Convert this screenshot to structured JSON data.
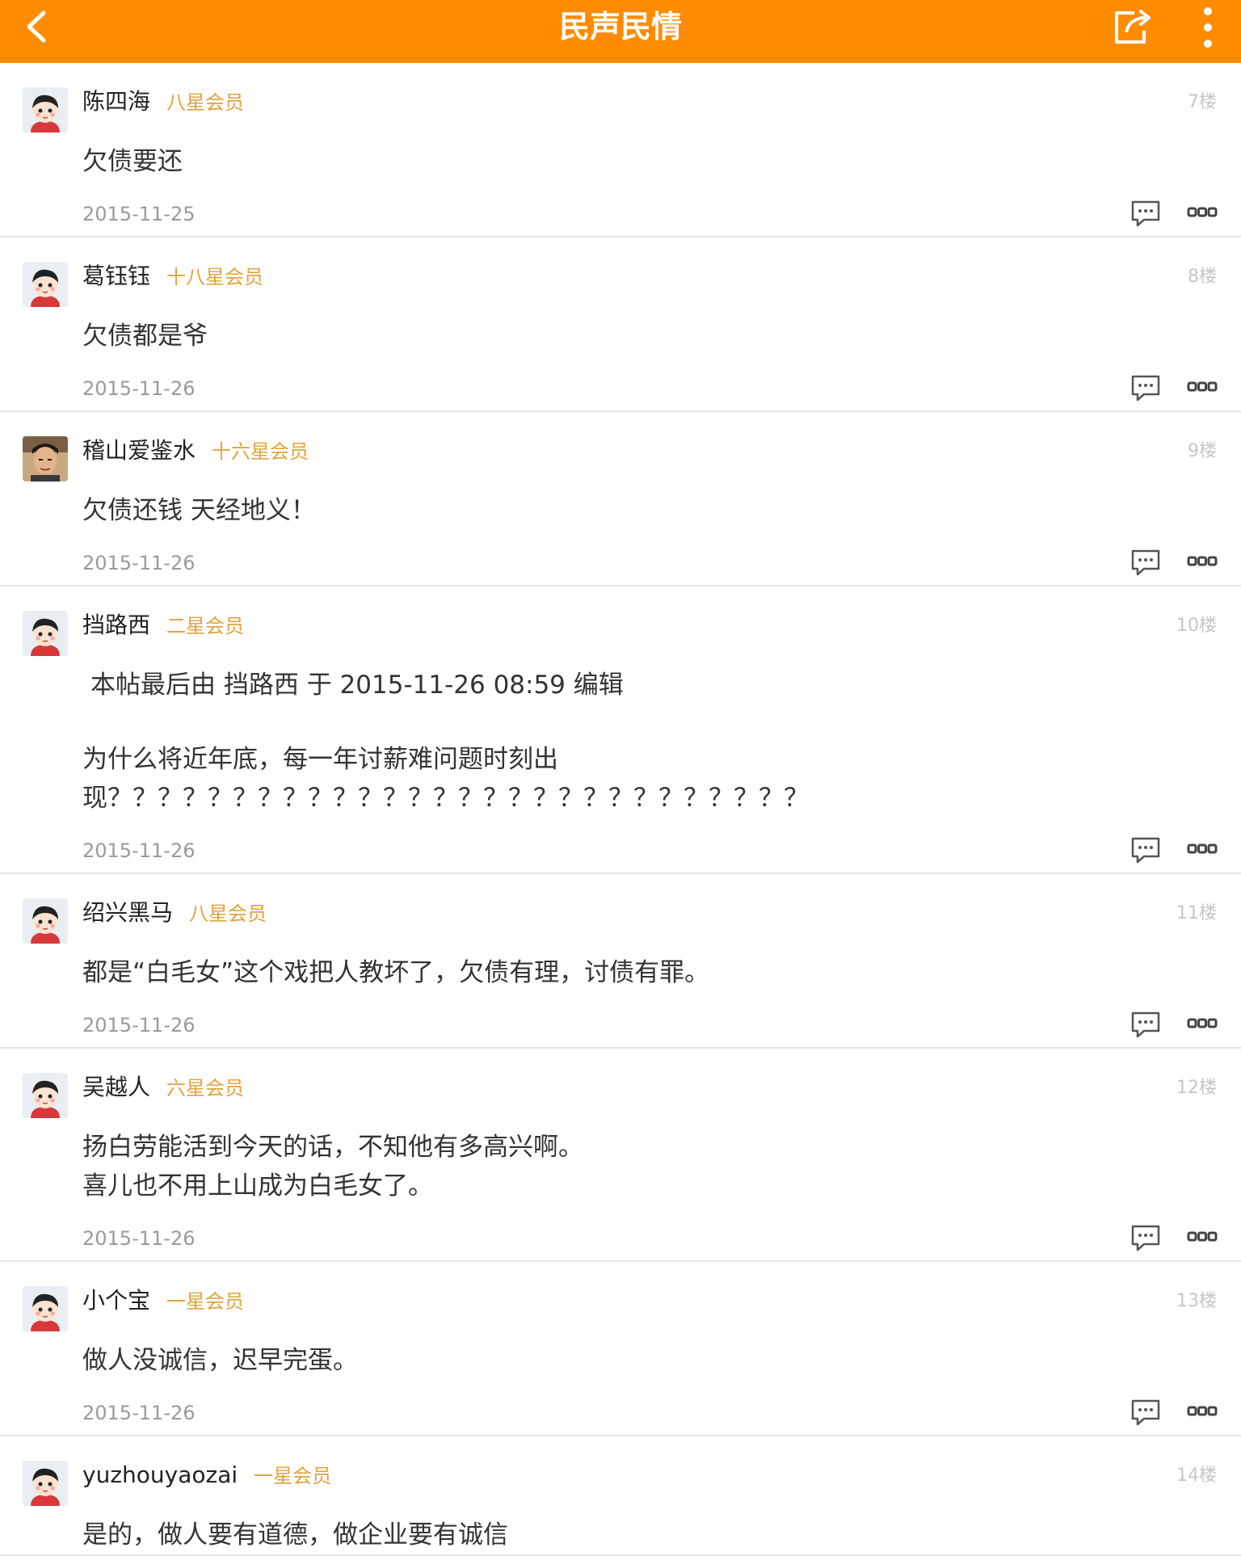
{
  "header": {
    "title": "民声民情",
    "background": "#ff8c00"
  },
  "icons": {
    "back": "back-arrow-icon",
    "share": "share-icon",
    "menu": "more-vertical-icon",
    "reply": "comment-icon",
    "more": "more-horizontal-icon"
  },
  "posts": [
    {
      "username": "陈四海",
      "rank": "八星会员",
      "floor": "7楼",
      "content": [
        "欠债要还"
      ],
      "date": "2015-11-25",
      "avatar": "default"
    },
    {
      "username": "葛钰钰",
      "rank": "十八星会员",
      "floor": "8楼",
      "content": [
        "欠债都是爷"
      ],
      "date": "2015-11-26",
      "avatar": "default"
    },
    {
      "username": "稽山爱鉴水",
      "rank": "十六星会员",
      "floor": "9楼",
      "content": [
        "欠债还钱 天经地义！"
      ],
      "date": "2015-11-26",
      "avatar": "photo"
    },
    {
      "username": "挡路西",
      "rank": "二星会员",
      "floor": "10楼",
      "edit_note": "本帖最后由 挡路西 于 2015-11-26 08:59 编辑",
      "content": [
        "为什么将近年底，每一年讨薪难问题时刻出",
        "现？？？？？？？？？？？？？？？？？？？？？？？？？？？？"
      ],
      "date": "2015-11-26",
      "avatar": "default"
    },
    {
      "username": "绍兴黑马",
      "rank": "八星会员",
      "floor": "11楼",
      "content": [
        "都是“白毛女”这个戏把人教坏了，欠债有理，讨债有罪。"
      ],
      "date": "2015-11-26",
      "avatar": "default"
    },
    {
      "username": "吴越人",
      "rank": "六星会员",
      "floor": "12楼",
      "content": [
        "扬白劳能活到今天的话，不知他有多高兴啊。",
        "喜儿也不用上山成为白毛女了。"
      ],
      "date": "2015-11-26",
      "avatar": "default"
    },
    {
      "username": "小个宝",
      "rank": "一星会员",
      "floor": "13楼",
      "content": [
        "做人没诚信，迟早完蛋。"
      ],
      "date": "2015-11-26",
      "avatar": "default"
    },
    {
      "username": "yuzhouyaozai",
      "rank": "一星会员",
      "floor": "14楼",
      "content": [
        "是的，做人要有道德，做企业要有诚信"
      ],
      "date": "",
      "avatar": "default"
    }
  ]
}
